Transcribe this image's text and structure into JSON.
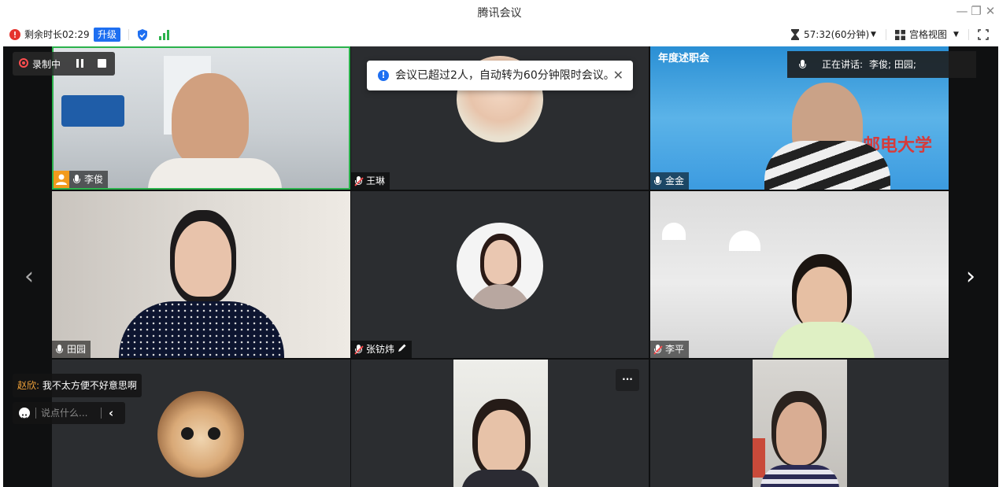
{
  "window": {
    "title": "腾讯会议",
    "minimize": "—",
    "restore": "❐",
    "close": "✕"
  },
  "toolbar": {
    "remaining_label": "剩余时长02:29",
    "upgrade_label": "升级",
    "timer": "57:32(60分钟)",
    "view_label": "宫格视图",
    "accent_color": "#1e6ff1"
  },
  "stage": {
    "toast_text": "会议已超过2人，自动转为60分钟限时会议。",
    "recording_label": "录制中",
    "speaking_label": "正在讲话:",
    "speaking_names": "李俊; 田园;",
    "chat_sender": "赵欣:",
    "chat_message": "我不太方便不好意思啊",
    "chat_placeholder": "说点什么...",
    "banner_text_1": "年度述职会",
    "banner_text_2": "邮电大学",
    "prev_arrow": "‹",
    "next_arrow": "›",
    "more_label": "···"
  },
  "participants": [
    {
      "name": "李俊",
      "mic": "on",
      "host": true
    },
    {
      "name": "王琳",
      "mic": "off"
    },
    {
      "name": "金金",
      "mic": "on"
    },
    {
      "name": "田园",
      "mic": "on"
    },
    {
      "name": "张钫炜",
      "mic": "off",
      "edit_icon": true
    },
    {
      "name": "李平",
      "mic": "off"
    },
    {
      "name": "",
      "mic": "none"
    },
    {
      "name": "",
      "mic": "none"
    },
    {
      "name": "",
      "mic": "none"
    }
  ]
}
